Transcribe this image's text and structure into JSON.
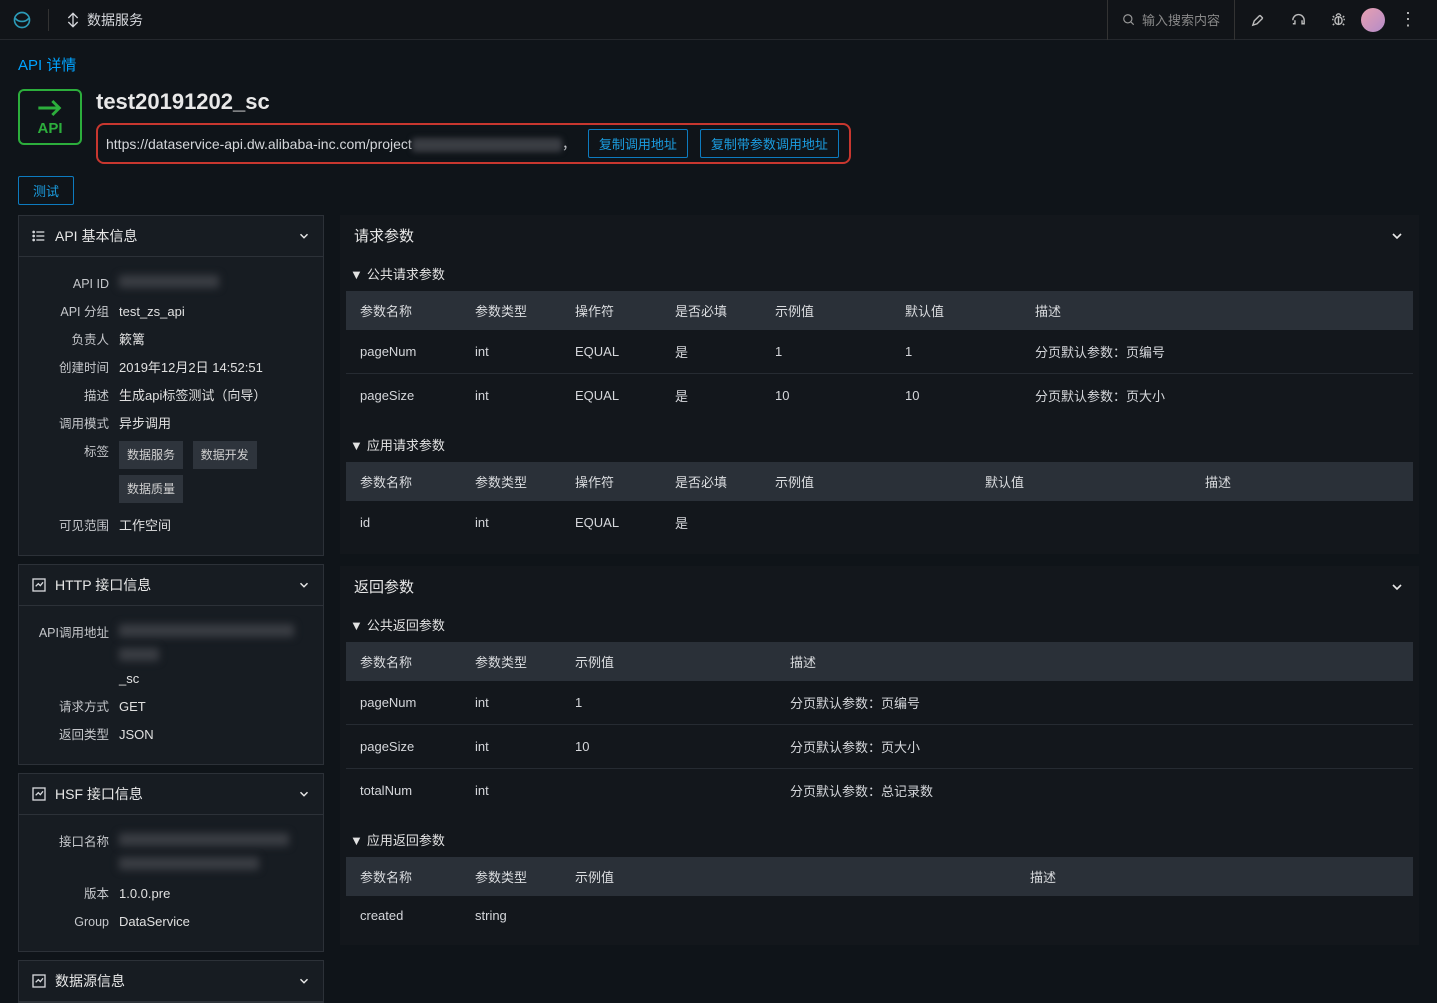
{
  "topbar": {
    "product": "数据服务",
    "searchPlaceholder": "输入搜索内容"
  },
  "page": {
    "title": "API 详情",
    "apiBadge": "API",
    "apiName": "test20191202_sc",
    "urlPrefix": "https://dataservice-api.dw.alibaba-inc.com/project",
    "btnCopyUrl": "复制调用地址",
    "btnCopyUrlParams": "复制带参数调用地址",
    "btnTest": "测试"
  },
  "basic": {
    "title": "API 基本信息",
    "rows": {
      "apiId": {
        "label": "API ID",
        "value": ""
      },
      "group": {
        "label": "API 分组",
        "value": "test_zs_api"
      },
      "owner": {
        "label": "负责人",
        "value": "簌篱"
      },
      "created": {
        "label": "创建时间",
        "value": "2019年12月2日 14:52:51"
      },
      "desc": {
        "label": "描述",
        "value": "生成api标签测试（向导）"
      },
      "mode": {
        "label": "调用模式",
        "value": "异步调用"
      },
      "tags": {
        "label": "标签"
      },
      "scope": {
        "label": "可见范围",
        "value": "工作空间"
      }
    },
    "tagValues": [
      "数据服务",
      "数据开发",
      "数据质量"
    ]
  },
  "http": {
    "title": "HTTP 接口信息",
    "rows": {
      "url": {
        "label": "API调用地址",
        "suffix": "_sc"
      },
      "method": {
        "label": "请求方式",
        "value": "GET"
      },
      "ret": {
        "label": "返回类型",
        "value": "JSON"
      }
    }
  },
  "hsf": {
    "title": "HSF 接口信息",
    "rows": {
      "iname": {
        "label": "接口名称"
      },
      "version": {
        "label": "版本",
        "value": "1.0.0.pre"
      },
      "group": {
        "label": "Group",
        "value": "DataService"
      }
    }
  },
  "ds": {
    "title": "数据源信息"
  },
  "req": {
    "title": "请求参数",
    "publicTitle": "公共请求参数",
    "appTitle": "应用请求参数",
    "headers": {
      "name": "参数名称",
      "type": "参数类型",
      "op": "操作符",
      "required": "是否必填",
      "sample": "示例值",
      "default": "默认值",
      "desc": "描述"
    },
    "publicRows": [
      {
        "name": "pageNum",
        "type": "int",
        "op": "EQUAL",
        "required": "是",
        "sample": "1",
        "default": "1",
        "desc": "分页默认参数：页编号"
      },
      {
        "name": "pageSize",
        "type": "int",
        "op": "EQUAL",
        "required": "是",
        "sample": "10",
        "default": "10",
        "desc": "分页默认参数：页大小"
      }
    ],
    "appRows": [
      {
        "name": "id",
        "type": "int",
        "op": "EQUAL",
        "required": "是",
        "sample": "",
        "default": "",
        "desc": ""
      }
    ]
  },
  "res": {
    "title": "返回参数",
    "publicTitle": "公共返回参数",
    "appTitle": "应用返回参数",
    "headers": {
      "name": "参数名称",
      "type": "参数类型",
      "sample": "示例值",
      "desc": "描述"
    },
    "publicRows": [
      {
        "name": "pageNum",
        "type": "int",
        "sample": "1",
        "desc": "分页默认参数：页编号"
      },
      {
        "name": "pageSize",
        "type": "int",
        "sample": "10",
        "desc": "分页默认参数：页大小"
      },
      {
        "name": "totalNum",
        "type": "int",
        "sample": "",
        "desc": "分页默认参数：总记录数"
      }
    ],
    "appRows": [
      {
        "name": "created",
        "type": "string",
        "sample": "",
        "desc": ""
      }
    ]
  }
}
